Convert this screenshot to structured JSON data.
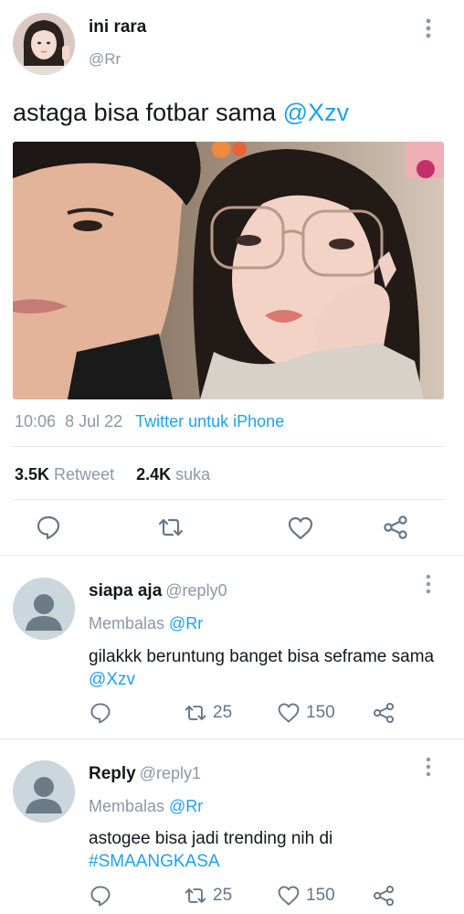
{
  "tweet": {
    "author_name": "ini rara",
    "author_handle": "@Rr",
    "text_prefix": "astaga bisa fotbar sama ",
    "text_mention": "@Xzv",
    "time": "10:06",
    "date": "8 Jul 22",
    "source": "Twitter untuk iPhone",
    "retweet_count": "3.5K",
    "retweet_label": "Retweet",
    "like_count": "2.4K",
    "like_label": "suka"
  },
  "actions": {
    "reply_icon": "reply-icon",
    "retweet_icon": "retweet-icon",
    "like_icon": "heart-icon",
    "share_icon": "share-icon"
  },
  "replies": [
    {
      "name": "siapa aja",
      "handle": "@reply0",
      "replying_label": "Membalas ",
      "replying_to": "@Rr",
      "text": "gilakkk beruntung banget bisa seframe sama ",
      "text_link": "@Xzv",
      "retweets": "25",
      "likes": "150"
    },
    {
      "name": "Reply",
      "handle": "@reply1",
      "replying_label": "Membalas ",
      "replying_to": "@Rr",
      "text": "astogee bisa jadi trending nih di ",
      "text_link": "#SMAANGKASA",
      "retweets": "25",
      "likes": "150"
    }
  ],
  "colors": {
    "link": "#1da1f2",
    "muted": "#8b98a5",
    "divider": "#e1e8ed",
    "icon": "#657786"
  }
}
